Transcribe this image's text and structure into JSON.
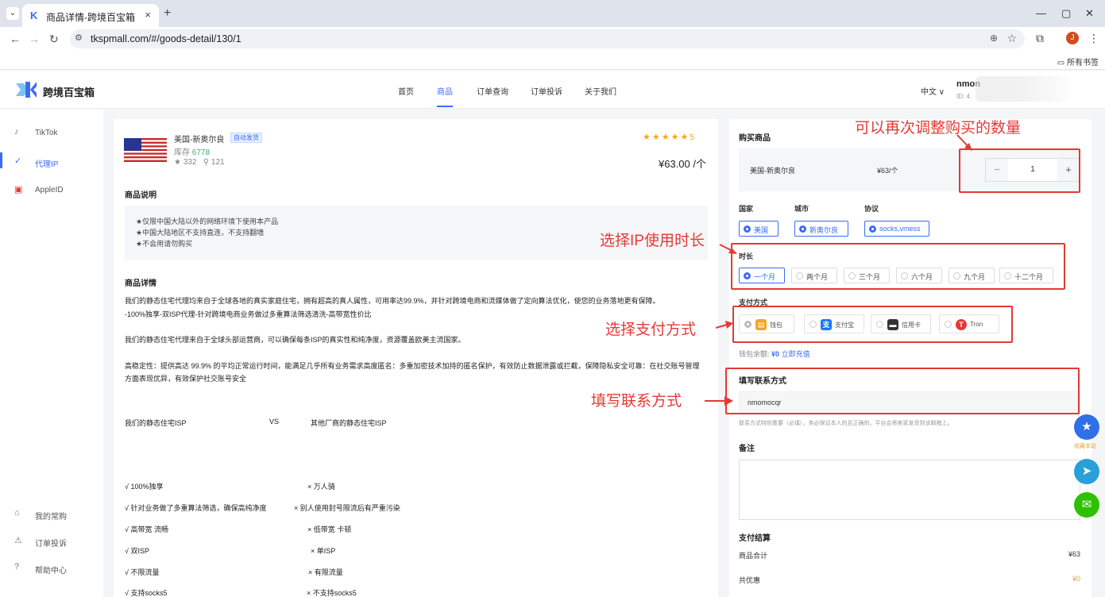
{
  "browser": {
    "tab_title": "商品详情-跨境百宝箱",
    "tab_close": "×",
    "new_tab": "+",
    "url": "tkspmall.com/#/goods-detail/130/1",
    "avatar_letter": "J",
    "bookmarks_label": "所有书签"
  },
  "header": {
    "logo_text": "跨境百宝箱",
    "nav": [
      "首页",
      "商品",
      "订单查询",
      "订单投诉",
      "关于我们"
    ],
    "active_nav": "商品",
    "lang": "中文 ∨",
    "user_name": "nmon",
    "user_id": "ID: 4"
  },
  "sidebar": {
    "items": [
      {
        "label": "TikTok",
        "icon": "tiktok-icon"
      },
      {
        "label": "代理IP",
        "icon": "proxy-icon"
      },
      {
        "label": "AppleID",
        "icon": "appleid-icon"
      }
    ],
    "bottom_items": [
      {
        "label": "我的常购",
        "icon": "home-icon"
      },
      {
        "label": "订单投诉",
        "icon": "warning-icon"
      },
      {
        "label": "帮助中心",
        "icon": "help-icon"
      }
    ]
  },
  "product": {
    "title": "美国-新奥尔良",
    "tag": "自动发货",
    "stock_label": "库存",
    "stock_value": "6778",
    "favorites": "332",
    "links": "121",
    "rating": "5",
    "price": "¥63.00 /个",
    "desc_title": "商品说明",
    "notes": [
      "★仅限中国大陆以外的网络环境下使用本产品",
      "★中国大陆地区不支持直连，不支持翻墙",
      "★不会用请勿购买"
    ],
    "detail_title": "商品详情",
    "detail_lines": [
      "我们的静态住宅代理均来自于全球各地的真实家庭住宅，拥有超高的真人属性，可用率达99.9%，并针对跨境电商和流媒体做了定向算法优化，使您的业务落地更有保障。",
      "-100%独享-双ISP代理-针对跨境电商业务做过多重算法筛选清洗-高带宽性价比",
      "我们的静态住宅代理来自于全球头部运营商，可以确保每条ISP的真实性和纯净度，资源覆盖欧美主流国家。",
      "高稳定性：提供高达 99.9% 的平均正常运行时间，能满足几乎所有业务需求高度匿名：多重加密技术加持的匿名保护，有效防止数据泄露或拦截，保障隐私安全可靠：在社交账号管理",
      "方面表现优异，有效保护社交账号安全"
    ],
    "compare": {
      "left_head": "我们的静态住宅ISP",
      "vs": "VS",
      "right_head": "其他厂商的静态住宅ISP",
      "left": [
        "√ 100%独享",
        "√ 针对业务做了多重算法筛选，确保高纯净度",
        "√ 高带宽 流畅",
        "√ 双ISP",
        "√ 不限流量",
        "√ 支持socks5"
      ],
      "right": [
        "× 万人骑",
        "× 别人使用封号限流后有严重污染",
        "× 低带宽 卡顿",
        "× 单ISP",
        "× 有限流量",
        "× 不支持socks5"
      ]
    }
  },
  "purchase": {
    "title": "购买商品",
    "item_name": "美国-新奥尔良",
    "item_price": "¥63/个",
    "minus": "−",
    "quantity": "1",
    "plus": "+",
    "country_label": "国家",
    "city_label": "城市",
    "protocol_label": "协议",
    "country": "美国",
    "city": "新奥尔良",
    "protocol": "socks,vmess",
    "duration_label": "时长",
    "durations": [
      "一个月",
      "两个月",
      "三个月",
      "六个月",
      "九个月",
      "十二个月"
    ],
    "selected_duration": "一个月",
    "payment_label": "支付方式",
    "payments": [
      {
        "label": "钱包",
        "icon": "wallet-icon",
        "color": "#f5a623"
      },
      {
        "label": "支付宝",
        "icon": "alipay-icon",
        "color": "#1677ff"
      },
      {
        "label": "信用卡",
        "icon": "credit-card-icon",
        "color": "#333333"
      },
      {
        "label": "Tron",
        "icon": "tron-icon",
        "color": "#e53935"
      }
    ],
    "balance_label": "钱包余额:",
    "balance_value": "¥0",
    "recharge": "立即充值",
    "contact_label": "填写联系方式",
    "contact_value": "nmomocqr",
    "contact_hint": "联系方式特别重要（必填），务必保证本人的且正确的，平台会将卖家发货到该邮箱上。",
    "remark_label": "备注",
    "settle_label": "支付结算",
    "subtotal_label": "商品合计",
    "subtotal_value": "¥63",
    "discount_label": "共优惠",
    "discount_value": "¥0"
  },
  "annotations": {
    "quantity": "可以再次调整购买的数量",
    "duration": "选择IP使用时长",
    "payment": "选择支付方式",
    "contact": "填写联系方式"
  },
  "floating": {
    "favorite_label": "收藏本站"
  },
  "colors": {
    "accent": "#3b6cf6",
    "annotation": "#e53935",
    "stock": "#2bb673",
    "star": "#f5a623"
  }
}
